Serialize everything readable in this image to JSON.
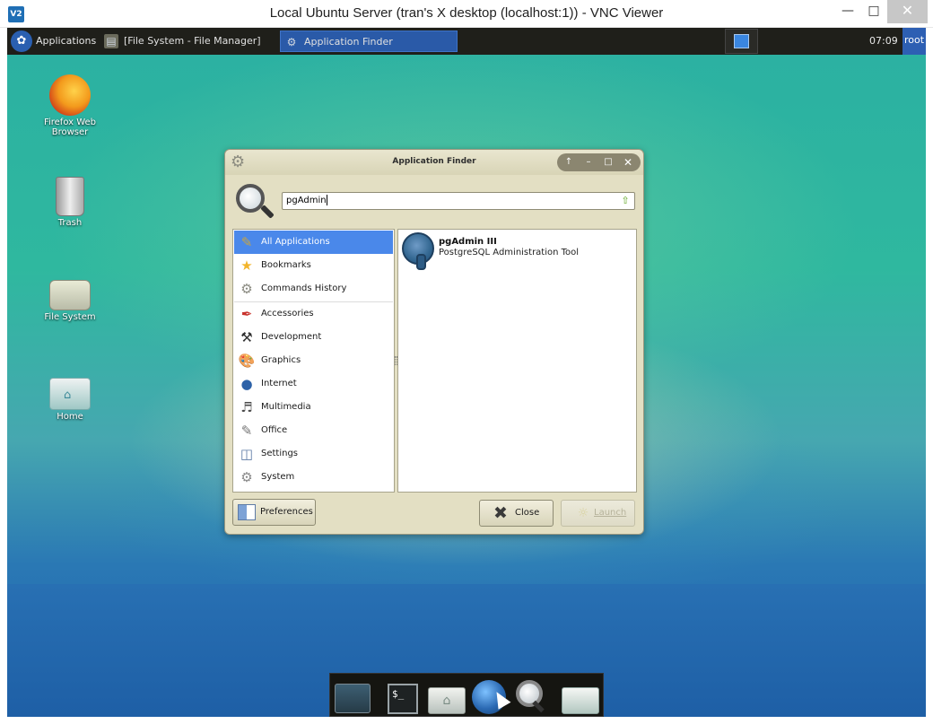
{
  "vnc": {
    "logo": "V2",
    "title": "Local Ubuntu Server (tran's X desktop (localhost:1)) - VNC Viewer",
    "minimize_glyph": "—",
    "maximize_glyph": "□",
    "close_glyph": "✕"
  },
  "panel": {
    "applications_label": "Applications",
    "tasks": [
      {
        "label": "[File System - File Manager]",
        "active": false
      },
      {
        "label": "Application Finder",
        "active": true
      }
    ],
    "clock": "07:09",
    "user": "root"
  },
  "desktop_icons": [
    {
      "label_line1": "Firefox Web",
      "label_line2": "Browser",
      "icon": "firefox-icon"
    },
    {
      "label_line1": "Trash",
      "label_line2": "",
      "icon": "trash-icon"
    },
    {
      "label_line1": "File System",
      "label_line2": "",
      "icon": "drive-icon"
    },
    {
      "label_line1": "Home",
      "label_line2": "",
      "icon": "home-folder-icon"
    }
  ],
  "finder": {
    "title": "Application Finder",
    "search_value": "pgAdmin",
    "categories": [
      {
        "label": "All Applications",
        "icon": "all-applications-icon",
        "selected": true
      },
      {
        "label": "Bookmarks",
        "icon": "star-icon",
        "selected": false
      },
      {
        "label": "Commands History",
        "icon": "gears-icon",
        "selected": false
      },
      {
        "label": "Accessories",
        "icon": "accessories-icon",
        "selected": false
      },
      {
        "label": "Development",
        "icon": "trowel-icon",
        "selected": false
      },
      {
        "label": "Graphics",
        "icon": "palette-icon",
        "selected": false
      },
      {
        "label": "Internet",
        "icon": "globe-icon",
        "selected": false
      },
      {
        "label": "Multimedia",
        "icon": "multimedia-icon",
        "selected": false
      },
      {
        "label": "Office",
        "icon": "office-icon",
        "selected": false
      },
      {
        "label": "Settings",
        "icon": "settings-icon",
        "selected": false
      },
      {
        "label": "System",
        "icon": "cog-icon",
        "selected": false
      }
    ],
    "results": [
      {
        "name": "pgAdmin III",
        "description": "PostgreSQL Administration Tool",
        "icon": "postgresql-elephant-icon"
      }
    ],
    "buttons": {
      "preferences": "Preferences",
      "close": "Close",
      "launch": "Launch"
    }
  },
  "dock": {
    "items": [
      "show-desktop-icon",
      "terminal-icon",
      "file-manager-icon",
      "web-browser-icon",
      "app-finder-icon",
      "folder-icon"
    ],
    "terminal_prompt": "$_"
  },
  "colors": {
    "selection": "#4a88ea",
    "panel": "#1f1f1a",
    "dialog": "#e3dfc3"
  }
}
